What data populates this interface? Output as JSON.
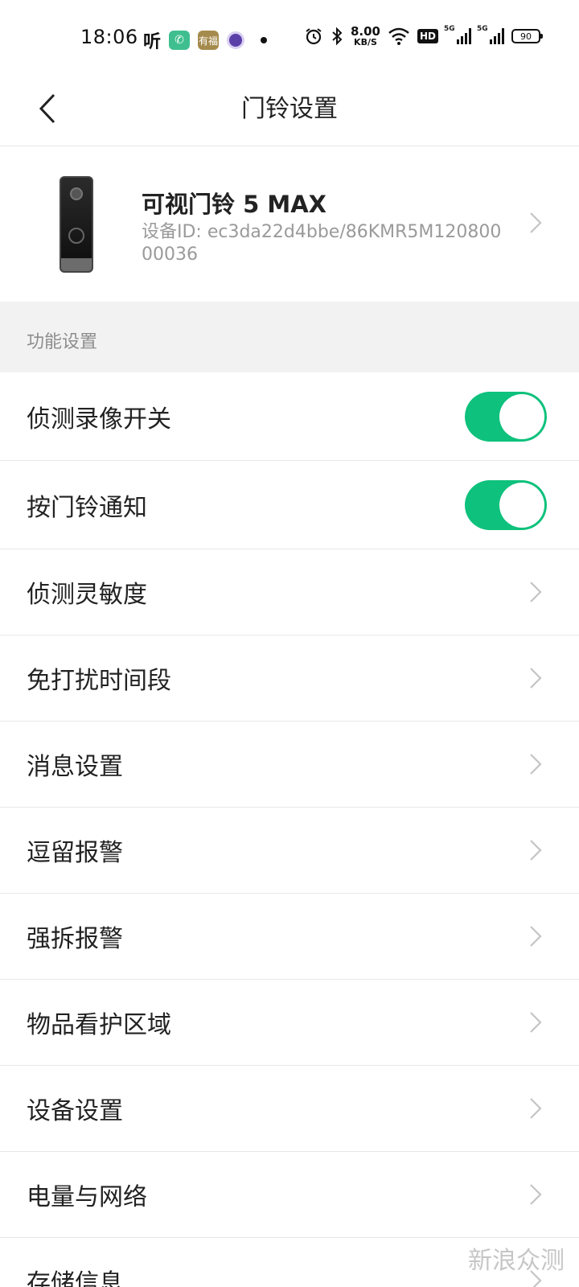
{
  "status_bar": {
    "time": "18:06",
    "app_ting_label": "听",
    "app_fu_label": "有福",
    "speed_value": "8.00",
    "speed_unit": "KB/S",
    "hd_label": "HD",
    "sig1_label": "5G",
    "sig2_label": "5G",
    "battery_level": "90"
  },
  "header": {
    "title": "门铃设置"
  },
  "device": {
    "name": "可视门铃 5 MAX",
    "id_text": "设备ID: ec3da22d4bbe/86KMR5M12080000036"
  },
  "section": {
    "title": "功能设置"
  },
  "settings": {
    "detect_record": {
      "label": "侦测录像开关",
      "enabled": true
    },
    "doorbell_notify": {
      "label": "按门铃通知",
      "enabled": true
    },
    "items": [
      "侦测灵敏度",
      "免打扰时间段",
      "消息设置",
      "逗留报警",
      "强拆报警",
      "物品看护区域",
      "设备设置",
      "电量与网络",
      "存储信息"
    ]
  },
  "colors": {
    "toggle_on": "#0ec17c",
    "section_bg": "#f2f2f2",
    "secondary_text": "#9a9a9a"
  },
  "watermark": "新浪众测"
}
